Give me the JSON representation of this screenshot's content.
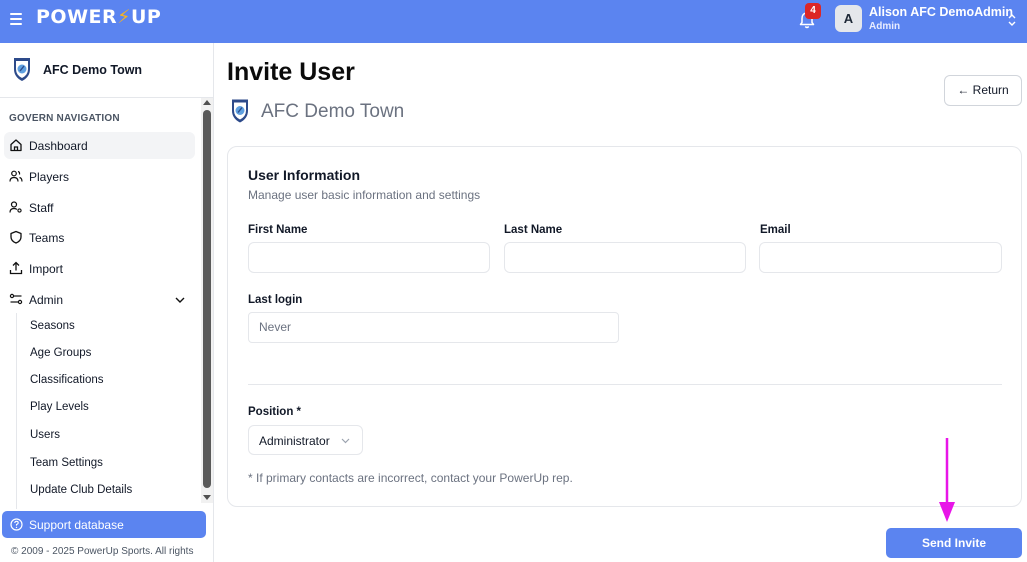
{
  "app": {
    "logo_text": "POWER",
    "logo_bolt": "⚡",
    "logo_text_end": "UP",
    "notification_count": "4",
    "user_initial": "A",
    "user_name": "Alison AFC DemoAdmin",
    "user_role": "Admin",
    "brand_color": "#5b84f0"
  },
  "sidebar": {
    "club_name": "AFC Demo Town",
    "nav_heading": "GOVERN NAVIGATION",
    "items": [
      {
        "label": "Dashboard",
        "icon": "home-icon"
      },
      {
        "label": "Players",
        "icon": "users-icon"
      },
      {
        "label": "Staff",
        "icon": "user-key-icon"
      },
      {
        "label": "Teams",
        "icon": "shield-icon"
      },
      {
        "label": "Import",
        "icon": "upload-icon"
      },
      {
        "label": "Admin",
        "icon": "sliders-icon"
      }
    ],
    "admin_subitems": [
      "Seasons",
      "Age Groups",
      "Classifications",
      "Play Levels",
      "Users",
      "Team Settings",
      "Update Club Details"
    ],
    "support_label": "Support database",
    "copyright": "© 2009 - 2025 PowerUp Sports. All rights"
  },
  "main": {
    "title": "Invite User",
    "club_name": "AFC Demo Town",
    "return_label": "← Return",
    "card": {
      "title": "User Information",
      "description": "Manage user basic information and settings",
      "first_name_label": "First Name",
      "first_name_value": "",
      "last_name_label": "Last Name",
      "last_name_value": "",
      "email_label": "Email",
      "email_value": "",
      "last_login_label": "Last login",
      "last_login_value": "Never",
      "position_label": "Position *",
      "position_value": "Administrator",
      "footnote": "* If primary contacts are incorrect, contact your PowerUp rep."
    },
    "send_invite_label": "Send Invite"
  }
}
